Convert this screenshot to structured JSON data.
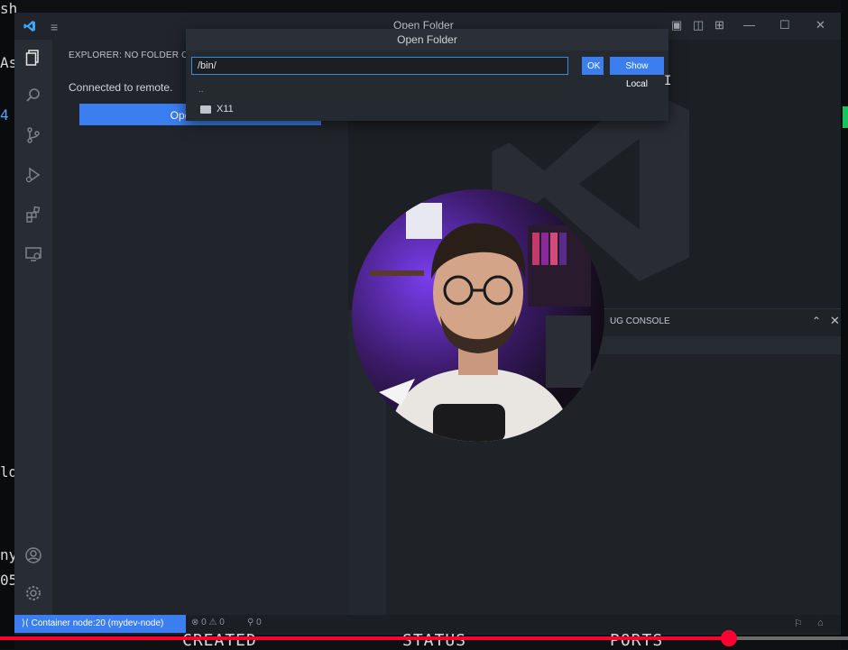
{
  "window": {
    "title": "Open Folder"
  },
  "sidebar": {
    "title": "EXPLORER: NO FOLDER OPEN",
    "connected": "Connected to remote.",
    "open_folder_button": "Open Folder"
  },
  "quickpick": {
    "path_value": "/bin/",
    "ok_label": "OK",
    "show_local_label": "Show Local",
    "parent_item": "..",
    "items": [
      {
        "label": "X11",
        "icon": "folder-icon"
      }
    ]
  },
  "panel": {
    "tab_label": "UG CONSOLE"
  },
  "statusbar": {
    "remote_label": "Container node:20 (mydev-node)",
    "problems": "⊗ 0 ⚠ 0",
    "ports": "⚲ 0"
  },
  "background_terminal": {
    "fragments": [
      "sh",
      "As",
      "4",
      "ld",
      "ny",
      "05"
    ],
    "bottom_headers": [
      "CREATED",
      "STATUS",
      "PORTS"
    ]
  },
  "video": {
    "progress": 0.86
  },
  "colors": {
    "accent": "#3a7ef0",
    "progress": "#ff0033",
    "sidebar_bg": "#21252b",
    "editor_bg": "#1c2025"
  },
  "icons": {
    "activity": [
      "files-icon",
      "search-icon",
      "source-control-icon",
      "run-debug-icon",
      "extensions-icon",
      "remote-explorer-icon",
      "account-icon",
      "settings-gear-icon"
    ]
  }
}
